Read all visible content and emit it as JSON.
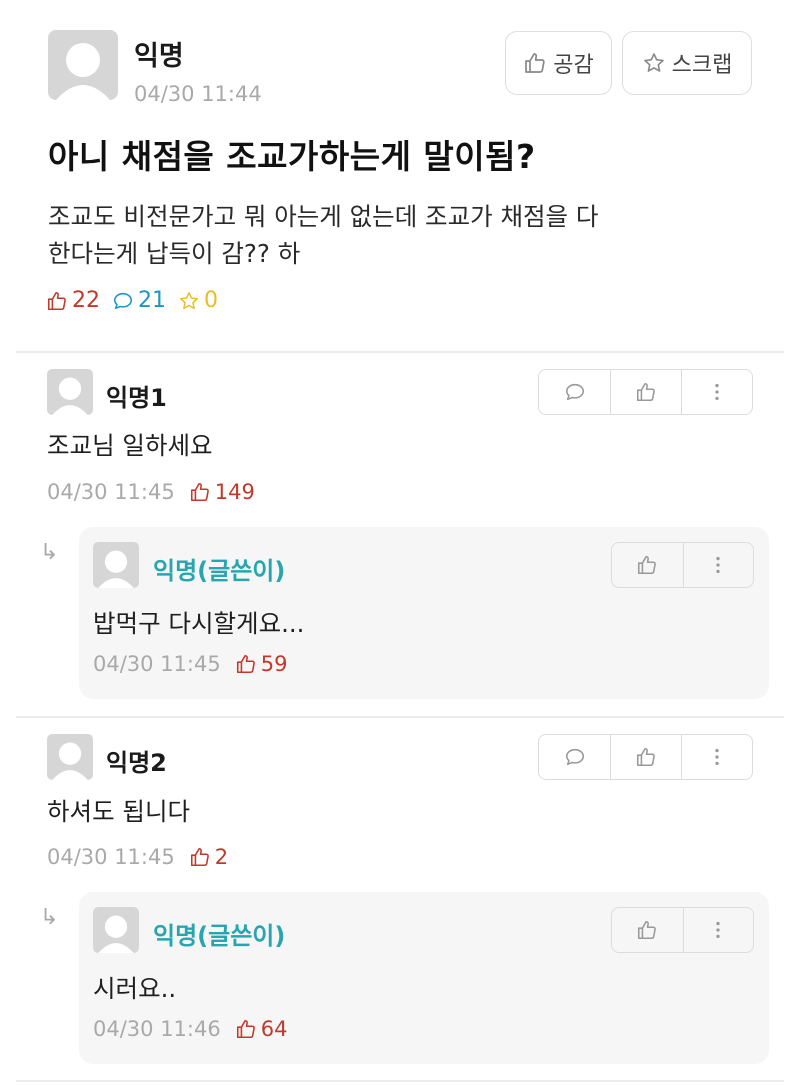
{
  "post": {
    "author": "익명",
    "time": "04/30 11:44",
    "like_button": "공감",
    "scrap_button": "스크랩",
    "title": "아니 채점을 조교가하는게 말이됨?",
    "body_line1": "조교도 비전문가고 뭐 아는게 없는데 조교가 채점을 다",
    "body_line2": "한다는게 납득이 감?? 하",
    "likes": "22",
    "comments": "21",
    "scraps": "0"
  },
  "comments": [
    {
      "author": "익명1",
      "text": "조교님 일하세요",
      "time": "04/30 11:45",
      "likes": "149",
      "reply": {
        "author": "익명(글쓴이)",
        "text": "밥먹구 다시할게요...",
        "time": "04/30 11:45",
        "likes": "59"
      }
    },
    {
      "author": "익명2",
      "text": "하셔도 됩니다",
      "time": "04/30 11:45",
      "likes": "2",
      "reply": {
        "author": "익명(글쓴이)",
        "text": "시러요..",
        "time": "04/30 11:46",
        "likes": "64"
      }
    }
  ],
  "icons": {
    "avatar": "default-avatar-icon",
    "like": "thumbs-up-icon",
    "comment": "speech-bubble-icon",
    "scrap": "star-icon",
    "more": "vertical-dots-icon",
    "reply": "reply-arrow-icon"
  },
  "colors": {
    "like": "#c0392b",
    "comment": "#1c96c7",
    "scrap": "#e8bd25",
    "op_author": "#27a6b0",
    "meta": "#a9a9a9"
  }
}
